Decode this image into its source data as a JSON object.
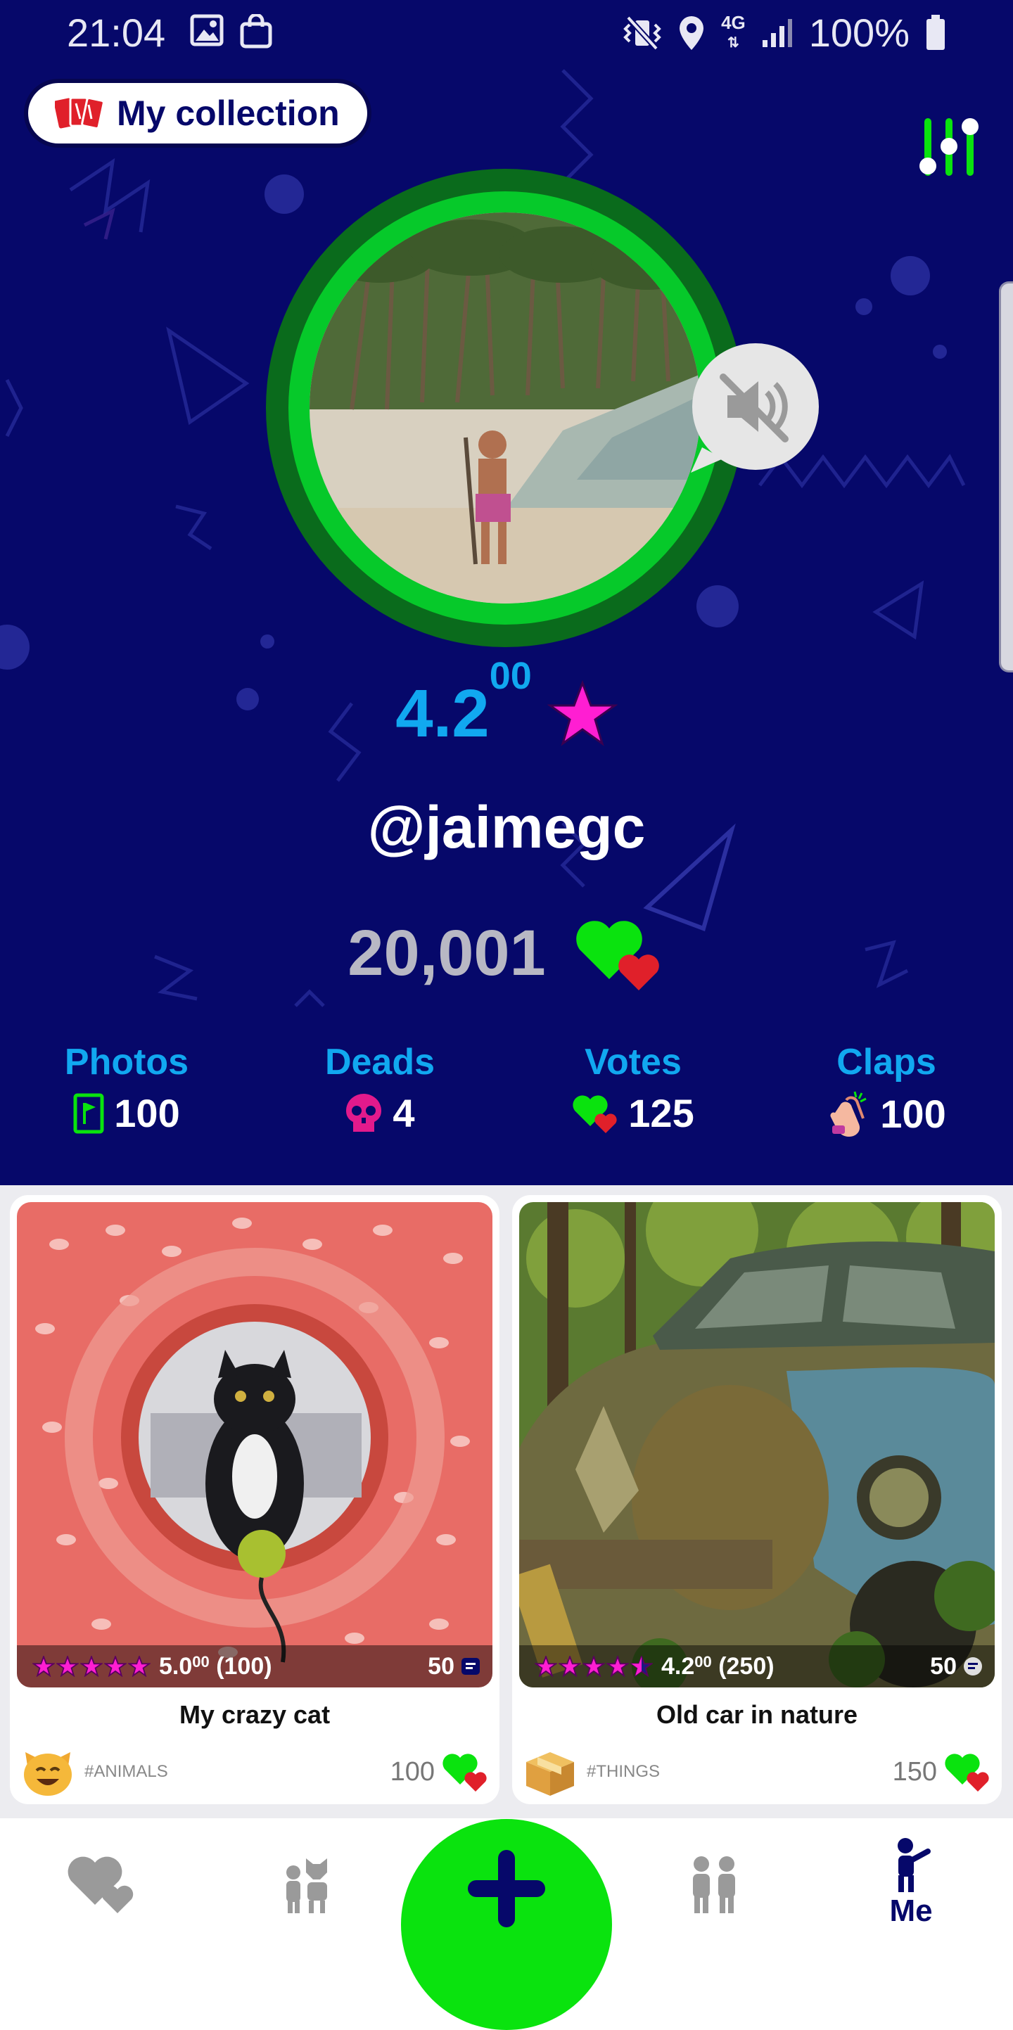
{
  "status_bar": {
    "time": "21:04",
    "battery": "100%",
    "network": "4G"
  },
  "header": {
    "collection_label": "My collection"
  },
  "profile": {
    "rating_main": "4.2",
    "rating_decimals": "00",
    "username": "@jaimegc",
    "hearts_count": "20,001"
  },
  "stats": [
    {
      "title": "Photos",
      "value": "100",
      "icon": "photo-flag-icon"
    },
    {
      "title": "Deads",
      "value": "4",
      "icon": "skull-icon"
    },
    {
      "title": "Votes",
      "value": "125",
      "icon": "hearts-icon"
    },
    {
      "title": "Claps",
      "value": "100",
      "icon": "clap-icon"
    }
  ],
  "cards": [
    {
      "title": "My crazy cat",
      "rating_main": "5.0",
      "rating_decimals": "00",
      "rating_count": "(100)",
      "stars": 5,
      "comments": "50",
      "tag": "#ANIMALS",
      "tag_icon": "cat-emoji-icon",
      "votes": "100"
    },
    {
      "title": "Old car in nature",
      "rating_main": "4.2",
      "rating_decimals": "00",
      "rating_count": "(250)",
      "stars": 4.2,
      "comments": "50",
      "tag": "#THINGS",
      "tag_icon": "box-emoji-icon",
      "votes": "150"
    }
  ],
  "nav": {
    "me_label": "Me"
  },
  "colors": {
    "background": "#06086a",
    "accent_blue": "#11a8f0",
    "green": "#0ae30e",
    "pink": "#ff00c8",
    "red": "#e0202a"
  }
}
